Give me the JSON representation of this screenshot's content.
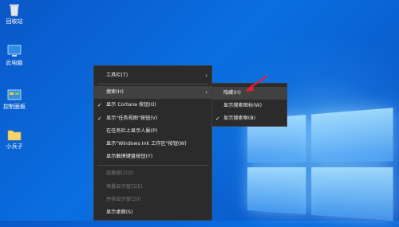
{
  "desktop": {
    "icons": [
      {
        "label": "回收站",
        "icon": "recycle-bin-icon"
      },
      {
        "label": "此电脑",
        "icon": "computer-icon"
      },
      {
        "label": "控制面板",
        "icon": "control-panel-icon"
      },
      {
        "label": "小兵子",
        "icon": "folder-icon"
      }
    ]
  },
  "context_menu": {
    "items": [
      {
        "label": "工具栏(T)",
        "checked": false,
        "submenu": true,
        "disabled": false
      },
      {
        "label": "搜索(H)",
        "checked": false,
        "submenu": true,
        "disabled": false,
        "hover": true
      },
      {
        "label": "显示 Cortana 按钮(O)",
        "checked": true,
        "submenu": false,
        "disabled": false
      },
      {
        "label": "显示\"任务视图\"按钮(V)",
        "checked": true,
        "submenu": false,
        "disabled": false
      },
      {
        "label": "在任务栏上显示人脉(P)",
        "checked": false,
        "submenu": false,
        "disabled": false
      },
      {
        "label": "显示\"Windows Ink 工作区\"按钮(W)",
        "checked": false,
        "submenu": false,
        "disabled": false
      },
      {
        "label": "显示触摸键盘按钮(Y)",
        "checked": false,
        "submenu": false,
        "disabled": false
      },
      {
        "label": "层叠窗口(D)",
        "checked": false,
        "submenu": false,
        "disabled": true
      },
      {
        "label": "堆叠显示窗口(E)",
        "checked": false,
        "submenu": false,
        "disabled": true
      },
      {
        "label": "并排显示窗口(I)",
        "checked": false,
        "submenu": false,
        "disabled": true
      },
      {
        "label": "显示桌面(S)",
        "checked": false,
        "submenu": false,
        "disabled": false
      }
    ],
    "check_glyph": "✓",
    "arrow_glyph": "›"
  },
  "search_submenu": {
    "items": [
      {
        "label": "隐藏(H)",
        "checked": false,
        "hover": true
      },
      {
        "label": "显示搜索图标(W)",
        "checked": false
      },
      {
        "label": "显示搜索框(B)",
        "checked": true
      }
    ]
  },
  "colors": {
    "accent_arrow": "#e81e2c",
    "menu_bg": "#2b2b2b"
  }
}
